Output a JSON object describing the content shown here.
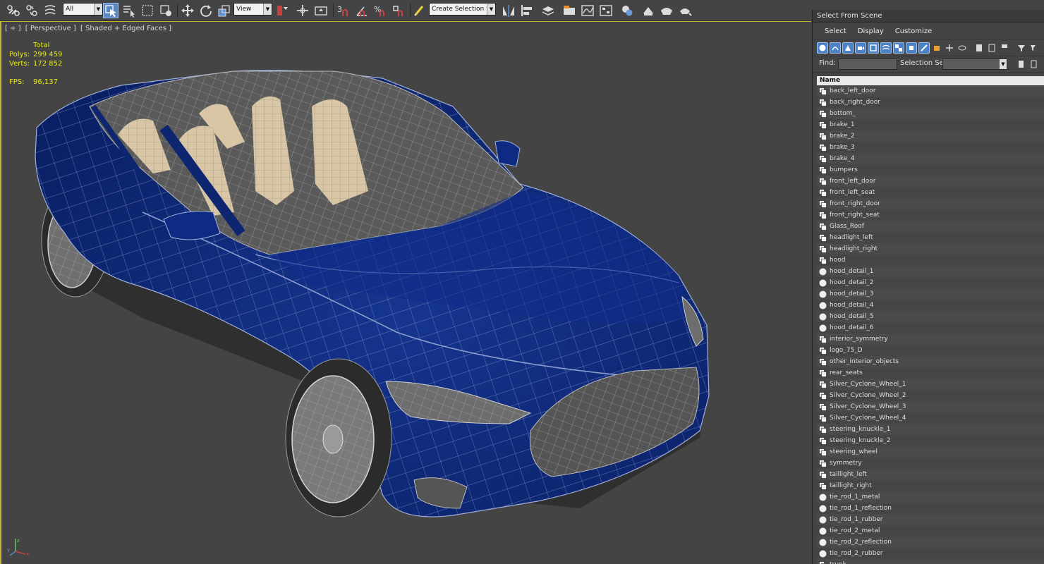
{
  "toolbar": {
    "selection_filter": "All",
    "reference_coord": "View",
    "named_selection": "Create Selection Se",
    "snap_label": "3",
    "percent_label": "%"
  },
  "viewport": {
    "label_plus": "[ + ]",
    "label_view": "[ Perspective ]",
    "label_shading": "[ Shaded + Edged Faces ]",
    "stats": {
      "total_label": "Total",
      "polys_label": "Polys:",
      "polys_value": "299 459",
      "verts_label": "Verts:",
      "verts_value": "172 852",
      "fps_label": "FPS:",
      "fps_value": "96,137"
    },
    "axis": {
      "x": "x",
      "y": "y",
      "z": "z"
    },
    "colors": {
      "body": "#0f2a82",
      "wire": "#9fb0d8",
      "seats": "#d8c6a6",
      "viewport_border": "#c9b437"
    }
  },
  "dialog": {
    "title": "Select From Scene",
    "menu": [
      "Select",
      "Display",
      "Customize"
    ],
    "find_label": "Find:",
    "find_value": "",
    "selection_set_label": "Selection Set:",
    "column_header": "Name",
    "objects": [
      {
        "name": "back_left_door",
        "icon": "object-icon"
      },
      {
        "name": "back_right_door",
        "icon": "object-icon"
      },
      {
        "name": "bottom_",
        "icon": "object-icon"
      },
      {
        "name": "brake_1",
        "icon": "object-icon"
      },
      {
        "name": "brake_2",
        "icon": "object-icon"
      },
      {
        "name": "brake_3",
        "icon": "object-icon"
      },
      {
        "name": "brake_4",
        "icon": "object-icon"
      },
      {
        "name": "bumpers",
        "icon": "object-icon"
      },
      {
        "name": "front_left_door",
        "icon": "object-icon"
      },
      {
        "name": "front_left_seat",
        "icon": "object-icon"
      },
      {
        "name": "front_right_door",
        "icon": "object-icon"
      },
      {
        "name": "front_right_seat",
        "icon": "object-icon"
      },
      {
        "name": "Glass_Roof",
        "icon": "object-icon"
      },
      {
        "name": "headlight_left",
        "icon": "object-icon"
      },
      {
        "name": "headlight_right",
        "icon": "object-icon"
      },
      {
        "name": "hood",
        "icon": "object-icon"
      },
      {
        "name": "hood_detail_1",
        "icon": "sphere-icon"
      },
      {
        "name": "hood_detail_2",
        "icon": "sphere-icon"
      },
      {
        "name": "hood_detail_3",
        "icon": "sphere-icon"
      },
      {
        "name": "hood_detail_4",
        "icon": "sphere-icon"
      },
      {
        "name": "hood_detail_5",
        "icon": "sphere-icon"
      },
      {
        "name": "hood_detail_6",
        "icon": "sphere-icon"
      },
      {
        "name": "interior_symmetry",
        "icon": "object-icon"
      },
      {
        "name": "logo_75_D",
        "icon": "object-icon"
      },
      {
        "name": "other_interior_objects",
        "icon": "object-icon"
      },
      {
        "name": "rear_seats",
        "icon": "object-icon"
      },
      {
        "name": "Silver_Cyclone_Wheel_1",
        "icon": "object-icon"
      },
      {
        "name": "Silver_Cyclone_Wheel_2",
        "icon": "object-icon"
      },
      {
        "name": "Silver_Cyclone_Wheel_3",
        "icon": "object-icon"
      },
      {
        "name": "Silver_Cyclone_Wheel_4",
        "icon": "object-icon"
      },
      {
        "name": "steering_knuckle_1",
        "icon": "object-icon"
      },
      {
        "name": "steering_knuckle_2",
        "icon": "object-icon"
      },
      {
        "name": "steering_wheel",
        "icon": "object-icon"
      },
      {
        "name": "symmetry",
        "icon": "object-icon"
      },
      {
        "name": "taillight_left",
        "icon": "object-icon"
      },
      {
        "name": "taillight_right",
        "icon": "object-icon"
      },
      {
        "name": "tie_rod_1_metal",
        "icon": "sphere-icon"
      },
      {
        "name": "tie_rod_1_reflection",
        "icon": "sphere-icon"
      },
      {
        "name": "tie_rod_1_rubber",
        "icon": "sphere-icon"
      },
      {
        "name": "tie_rod_2_metal",
        "icon": "sphere-icon"
      },
      {
        "name": "tie_rod_2_reflection",
        "icon": "sphere-icon"
      },
      {
        "name": "tie_rod_2_rubber",
        "icon": "sphere-icon"
      },
      {
        "name": "trunk",
        "icon": "object-icon"
      }
    ]
  }
}
